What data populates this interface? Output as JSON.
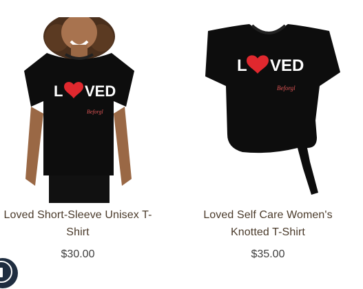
{
  "products": [
    {
      "title_line1": "Loved Short-Sleeve Unisex T-",
      "title_line2": "Shirt",
      "price": "$30.00",
      "print_text": "L",
      "print_text_2": "VED",
      "signature": "Beforgl",
      "image_icon": "model-wearing-tshirt-image"
    },
    {
      "title_line1": "Loved Self Care Women's",
      "title_line2": "Knotted T-Shirt",
      "price": "$35.00",
      "print_text": "L",
      "print_text_2": "VED",
      "signature": "Beforgl",
      "image_icon": "knotted-tshirt-image"
    }
  ],
  "colors": {
    "shirt": "#0d0d0d",
    "heart": "#e0282e",
    "title": "#4a3a2a",
    "price": "#3e3e3e",
    "cart_button": "#1f2d40"
  },
  "cart_button": {
    "icon": "shopping-bag-icon"
  }
}
